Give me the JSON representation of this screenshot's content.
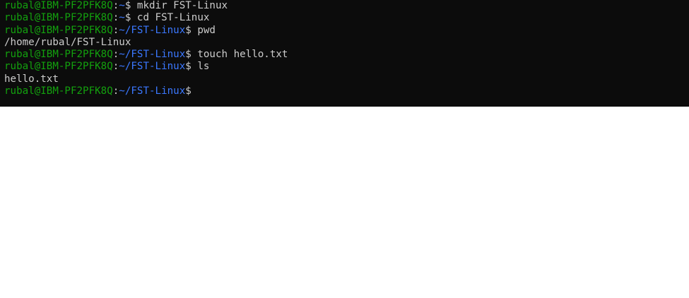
{
  "terminal": {
    "lines": [
      {
        "type": "prompt",
        "user": "rubal@IBM-PF2PFK8Q",
        "colon": ":",
        "path": "~",
        "dollar": "$",
        "command": " mkdir FST-Linux"
      },
      {
        "type": "prompt",
        "user": "rubal@IBM-PF2PFK8Q",
        "colon": ":",
        "path": "~",
        "dollar": "$",
        "command": " cd FST-Linux"
      },
      {
        "type": "prompt",
        "user": "rubal@IBM-PF2PFK8Q",
        "colon": ":",
        "path": "~/FST-Linux",
        "dollar": "$",
        "command": " pwd"
      },
      {
        "type": "output",
        "text": "/home/rubal/FST-Linux"
      },
      {
        "type": "prompt",
        "user": "rubal@IBM-PF2PFK8Q",
        "colon": ":",
        "path": "~/FST-Linux",
        "dollar": "$",
        "command": " touch hello.txt"
      },
      {
        "type": "prompt",
        "user": "rubal@IBM-PF2PFK8Q",
        "colon": ":",
        "path": "~/FST-Linux",
        "dollar": "$",
        "command": " ls"
      },
      {
        "type": "output",
        "text": "hello.txt"
      },
      {
        "type": "prompt",
        "user": "rubal@IBM-PF2PFK8Q",
        "colon": ":",
        "path": "~/FST-Linux",
        "dollar": "$",
        "command": ""
      }
    ],
    "colors": {
      "background": "#0c0c0c",
      "user": "#13a10e",
      "path": "#3b78ff",
      "text": "#cccccc"
    }
  }
}
